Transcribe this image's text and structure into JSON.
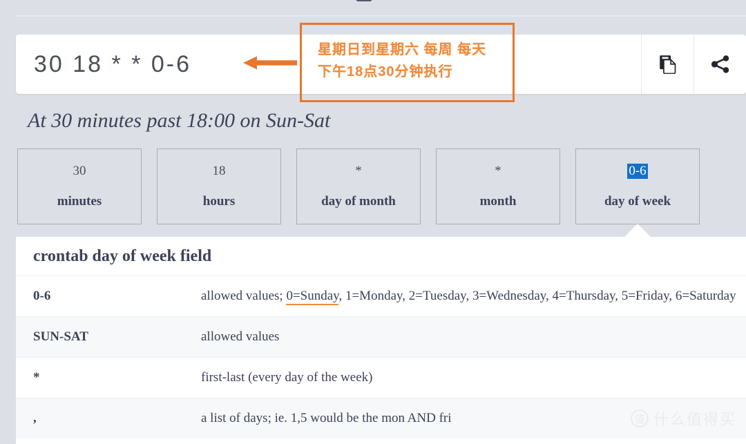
{
  "page": {
    "background_color": "#dcdfe6",
    "accent_orange": "#e8762c",
    "selection_blue": "#1570c8"
  },
  "expression": {
    "value": "30 18 * * 0-6",
    "placeholder": "* * * * *",
    "copy_icon": "copy-document-icon",
    "share_icon": "share-icon"
  },
  "annotation": {
    "line1": "星期日到星期六 每周 每天",
    "line2": "下午18点30分钟执行",
    "arrow_icon": "left-arrow-icon",
    "color": "#ef8b3c"
  },
  "description": "At 30 minutes past 18:00 on Sun-Sat",
  "fields": [
    {
      "value": "30",
      "label": "minutes",
      "active": false,
      "selected": false
    },
    {
      "value": "18",
      "label": "hours",
      "active": false,
      "selected": false
    },
    {
      "value": "*",
      "label": "day of month",
      "active": false,
      "selected": false
    },
    {
      "value": "*",
      "label": "month",
      "active": false,
      "selected": false
    },
    {
      "value": "0-6",
      "label": "day of week",
      "active": true,
      "selected": true
    }
  ],
  "panel": {
    "title": "crontab day of week field",
    "rows": [
      {
        "key": "0-6",
        "desc_before": "allowed values; ",
        "desc_highlight": "0=Sunday",
        "desc_after": ", 1=Monday, 2=Tuesday, 3=Wednesday, 4=Thursday, 5=Friday, 6=Saturday"
      },
      {
        "key": "SUN-SAT",
        "desc_before": "allowed values",
        "desc_highlight": "",
        "desc_after": ""
      },
      {
        "key": "*",
        "desc_before": "first-last (every day of the week)",
        "desc_highlight": "",
        "desc_after": ""
      },
      {
        "key": ",",
        "desc_before": "a list of days; ie. 1,5 would be the mon AND fri",
        "desc_highlight": "",
        "desc_after": ""
      }
    ]
  },
  "watermark": {
    "badge": "值",
    "text": "什么值得买"
  }
}
